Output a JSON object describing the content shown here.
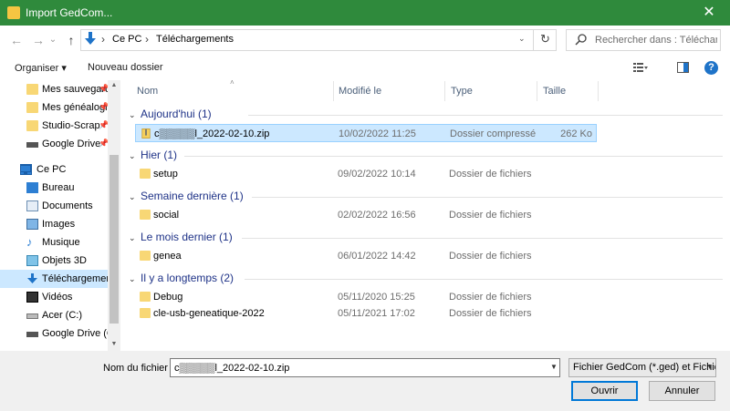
{
  "window": {
    "title": "Import GedCom...",
    "close_label": "✕"
  },
  "nav": {
    "back": "←",
    "forward": "→",
    "recent": "⌄",
    "up": "↑"
  },
  "address": {
    "crumbs": [
      "Ce PC",
      "Téléchargements"
    ],
    "separator": "›",
    "dropdown": "⌄",
    "refresh": "↻"
  },
  "search": {
    "placeholder": "Rechercher dans : Téléchargements"
  },
  "toolbar": {
    "organize": "Organiser ▾",
    "new_folder": "Nouveau dossier",
    "help": "?"
  },
  "sidebar": {
    "items": [
      {
        "label": "Mes sauvegardes",
        "icon": "folder-icon",
        "pinned": true
      },
      {
        "label": "Mes généalogies",
        "icon": "folder-icon",
        "pinned": true
      },
      {
        "label": "Studio-Scrap",
        "icon": "folder-icon",
        "pinned": true
      },
      {
        "label": "Google Drive",
        "icon": "drive-icon",
        "pinned": true
      },
      {
        "label": "Ce PC",
        "icon": "pc-icon",
        "pinned": false
      },
      {
        "label": "Bureau",
        "icon": "desktop-icon",
        "pinned": false
      },
      {
        "label": "Documents",
        "icon": "documents-icon",
        "pinned": false
      },
      {
        "label": "Images",
        "icon": "images-icon",
        "pinned": false
      },
      {
        "label": "Musique",
        "icon": "music-icon",
        "pinned": false
      },
      {
        "label": "Objets 3D",
        "icon": "objects3d-icon",
        "pinned": false
      },
      {
        "label": "Téléchargements",
        "icon": "downloads-icon",
        "pinned": false,
        "selected": true
      },
      {
        "label": "Vidéos",
        "icon": "videos-icon",
        "pinned": false
      },
      {
        "label": "Acer (C:)",
        "icon": "disk-icon",
        "pinned": false
      },
      {
        "label": "Google Drive (G:)",
        "icon": "drive-icon",
        "pinned": false
      }
    ]
  },
  "columns": {
    "name": "Nom",
    "modified": "Modifié le",
    "type": "Type",
    "size": "Taille"
  },
  "groups": [
    {
      "label": "Aujourd'hui (1)",
      "rows": [
        {
          "name": "c▒▒▒▒▒l_2022-02-10.zip",
          "date": "10/02/2022 11:25",
          "type": "Dossier compressé",
          "size": "262 Ko",
          "icon": "zip-icon",
          "selected": true
        }
      ]
    },
    {
      "label": "Hier (1)",
      "rows": [
        {
          "name": "setup",
          "date": "09/02/2022 10:14",
          "type": "Dossier de fichiers",
          "size": "",
          "icon": "folder-icon"
        }
      ]
    },
    {
      "label": "Semaine dernière (1)",
      "rows": [
        {
          "name": "social",
          "date": "02/02/2022 16:56",
          "type": "Dossier de fichiers",
          "size": "",
          "icon": "folder-icon"
        }
      ]
    },
    {
      "label": "Le mois dernier (1)",
      "rows": [
        {
          "name": "genea",
          "date": "06/01/2022 14:42",
          "type": "Dossier de fichiers",
          "size": "",
          "icon": "folder-icon"
        }
      ]
    },
    {
      "label": "Il y a longtemps (2)",
      "rows": [
        {
          "name": "Debug",
          "date": "05/11/2020 15:25",
          "type": "Dossier de fichiers",
          "size": "",
          "icon": "folder-icon"
        },
        {
          "name": "cle-usb-geneatique-2022",
          "date": "05/11/2021 17:02",
          "type": "Dossier de fichiers",
          "size": "",
          "icon": "folder-icon"
        }
      ]
    }
  ],
  "bottom": {
    "filename_label": "Nom du fichier :",
    "filename_value": "c▒▒▒▒▒l_2022-02-10.zip",
    "filter_value": "Fichier GedCom (*.ged) et Fichiers zip",
    "open_label": "Ouvrir",
    "cancel_label": "Annuler"
  }
}
